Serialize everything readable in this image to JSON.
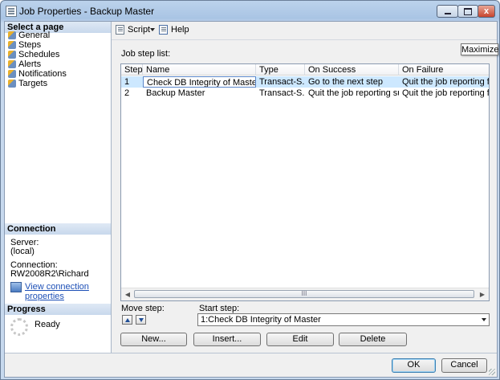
{
  "window": {
    "title": "Job Properties - Backup Master",
    "close_glyph": "x"
  },
  "sidebar": {
    "header": "Select a page",
    "items": [
      {
        "label": "General",
        "icon": "page-icon"
      },
      {
        "label": "Steps",
        "icon": "page-icon"
      },
      {
        "label": "Schedules",
        "icon": "page-icon"
      },
      {
        "label": "Alerts",
        "icon": "page-icon"
      },
      {
        "label": "Notifications",
        "icon": "page-icon"
      },
      {
        "label": "Targets",
        "icon": "page-icon"
      }
    ]
  },
  "connection": {
    "header": "Connection",
    "server_label": "Server:",
    "server_value": "(local)",
    "connection_label": "Connection:",
    "connection_value": "RW2008R2\\Richard",
    "link": "View connection properties"
  },
  "progress": {
    "header": "Progress",
    "status": "Ready"
  },
  "toolbar": {
    "script_label": "Script",
    "help_label": "Help",
    "tooltip": "Maximize"
  },
  "steps": {
    "list_label": "Job step list:",
    "columns": [
      "Step",
      "Name",
      "Type",
      "On Success",
      "On Failure"
    ],
    "rows": [
      [
        "1",
        "Check DB Integrity of Master",
        "Transact-S...",
        "Go to the next step",
        "Quit the job reporting failure"
      ],
      [
        "2",
        "Backup Master",
        "Transact-S...",
        "Quit the job reporting success",
        "Quit the job reporting failure"
      ]
    ],
    "scroll_thumb_glyph": "III"
  },
  "move_step": {
    "label": "Move step:"
  },
  "start_step": {
    "label": "Start step:",
    "value": "1:Check DB Integrity of Master"
  },
  "actions": {
    "new": "New...",
    "insert": "Insert...",
    "edit": "Edit",
    "delete": "Delete"
  },
  "dialog": {
    "ok": "OK",
    "cancel": "Cancel"
  }
}
